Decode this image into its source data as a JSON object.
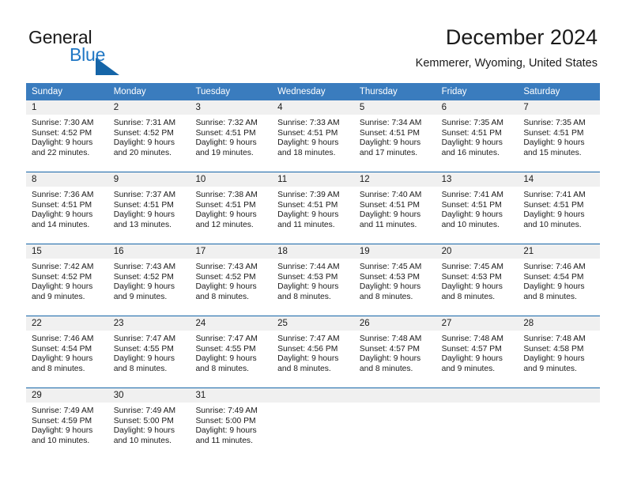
{
  "brand": {
    "word1": "General",
    "word2": "Blue",
    "accent_color": "#1565a8",
    "text_color": "#1a1a1a"
  },
  "header": {
    "title": "December 2024",
    "subtitle": "Kemmerer, Wyoming, United States"
  },
  "theme": {
    "header_bg": "#3a7cbe",
    "header_text": "#ffffff",
    "row_divider": "#1565a8",
    "day_strip_bg": "#f0f0f0"
  },
  "weekdays": [
    "Sunday",
    "Monday",
    "Tuesday",
    "Wednesday",
    "Thursday",
    "Friday",
    "Saturday"
  ],
  "weeks": [
    [
      {
        "day": "1",
        "sunrise": "Sunrise: 7:30 AM",
        "sunset": "Sunset: 4:52 PM",
        "daylight1": "Daylight: 9 hours",
        "daylight2": "and 22 minutes."
      },
      {
        "day": "2",
        "sunrise": "Sunrise: 7:31 AM",
        "sunset": "Sunset: 4:52 PM",
        "daylight1": "Daylight: 9 hours",
        "daylight2": "and 20 minutes."
      },
      {
        "day": "3",
        "sunrise": "Sunrise: 7:32 AM",
        "sunset": "Sunset: 4:51 PM",
        "daylight1": "Daylight: 9 hours",
        "daylight2": "and 19 minutes."
      },
      {
        "day": "4",
        "sunrise": "Sunrise: 7:33 AM",
        "sunset": "Sunset: 4:51 PM",
        "daylight1": "Daylight: 9 hours",
        "daylight2": "and 18 minutes."
      },
      {
        "day": "5",
        "sunrise": "Sunrise: 7:34 AM",
        "sunset": "Sunset: 4:51 PM",
        "daylight1": "Daylight: 9 hours",
        "daylight2": "and 17 minutes."
      },
      {
        "day": "6",
        "sunrise": "Sunrise: 7:35 AM",
        "sunset": "Sunset: 4:51 PM",
        "daylight1": "Daylight: 9 hours",
        "daylight2": "and 16 minutes."
      },
      {
        "day": "7",
        "sunrise": "Sunrise: 7:35 AM",
        "sunset": "Sunset: 4:51 PM",
        "daylight1": "Daylight: 9 hours",
        "daylight2": "and 15 minutes."
      }
    ],
    [
      {
        "day": "8",
        "sunrise": "Sunrise: 7:36 AM",
        "sunset": "Sunset: 4:51 PM",
        "daylight1": "Daylight: 9 hours",
        "daylight2": "and 14 minutes."
      },
      {
        "day": "9",
        "sunrise": "Sunrise: 7:37 AM",
        "sunset": "Sunset: 4:51 PM",
        "daylight1": "Daylight: 9 hours",
        "daylight2": "and 13 minutes."
      },
      {
        "day": "10",
        "sunrise": "Sunrise: 7:38 AM",
        "sunset": "Sunset: 4:51 PM",
        "daylight1": "Daylight: 9 hours",
        "daylight2": "and 12 minutes."
      },
      {
        "day": "11",
        "sunrise": "Sunrise: 7:39 AM",
        "sunset": "Sunset: 4:51 PM",
        "daylight1": "Daylight: 9 hours",
        "daylight2": "and 11 minutes."
      },
      {
        "day": "12",
        "sunrise": "Sunrise: 7:40 AM",
        "sunset": "Sunset: 4:51 PM",
        "daylight1": "Daylight: 9 hours",
        "daylight2": "and 11 minutes."
      },
      {
        "day": "13",
        "sunrise": "Sunrise: 7:41 AM",
        "sunset": "Sunset: 4:51 PM",
        "daylight1": "Daylight: 9 hours",
        "daylight2": "and 10 minutes."
      },
      {
        "day": "14",
        "sunrise": "Sunrise: 7:41 AM",
        "sunset": "Sunset: 4:51 PM",
        "daylight1": "Daylight: 9 hours",
        "daylight2": "and 10 minutes."
      }
    ],
    [
      {
        "day": "15",
        "sunrise": "Sunrise: 7:42 AM",
        "sunset": "Sunset: 4:52 PM",
        "daylight1": "Daylight: 9 hours",
        "daylight2": "and 9 minutes."
      },
      {
        "day": "16",
        "sunrise": "Sunrise: 7:43 AM",
        "sunset": "Sunset: 4:52 PM",
        "daylight1": "Daylight: 9 hours",
        "daylight2": "and 9 minutes."
      },
      {
        "day": "17",
        "sunrise": "Sunrise: 7:43 AM",
        "sunset": "Sunset: 4:52 PM",
        "daylight1": "Daylight: 9 hours",
        "daylight2": "and 8 minutes."
      },
      {
        "day": "18",
        "sunrise": "Sunrise: 7:44 AM",
        "sunset": "Sunset: 4:53 PM",
        "daylight1": "Daylight: 9 hours",
        "daylight2": "and 8 minutes."
      },
      {
        "day": "19",
        "sunrise": "Sunrise: 7:45 AM",
        "sunset": "Sunset: 4:53 PM",
        "daylight1": "Daylight: 9 hours",
        "daylight2": "and 8 minutes."
      },
      {
        "day": "20",
        "sunrise": "Sunrise: 7:45 AM",
        "sunset": "Sunset: 4:53 PM",
        "daylight1": "Daylight: 9 hours",
        "daylight2": "and 8 minutes."
      },
      {
        "day": "21",
        "sunrise": "Sunrise: 7:46 AM",
        "sunset": "Sunset: 4:54 PM",
        "daylight1": "Daylight: 9 hours",
        "daylight2": "and 8 minutes."
      }
    ],
    [
      {
        "day": "22",
        "sunrise": "Sunrise: 7:46 AM",
        "sunset": "Sunset: 4:54 PM",
        "daylight1": "Daylight: 9 hours",
        "daylight2": "and 8 minutes."
      },
      {
        "day": "23",
        "sunrise": "Sunrise: 7:47 AM",
        "sunset": "Sunset: 4:55 PM",
        "daylight1": "Daylight: 9 hours",
        "daylight2": "and 8 minutes."
      },
      {
        "day": "24",
        "sunrise": "Sunrise: 7:47 AM",
        "sunset": "Sunset: 4:55 PM",
        "daylight1": "Daylight: 9 hours",
        "daylight2": "and 8 minutes."
      },
      {
        "day": "25",
        "sunrise": "Sunrise: 7:47 AM",
        "sunset": "Sunset: 4:56 PM",
        "daylight1": "Daylight: 9 hours",
        "daylight2": "and 8 minutes."
      },
      {
        "day": "26",
        "sunrise": "Sunrise: 7:48 AM",
        "sunset": "Sunset: 4:57 PM",
        "daylight1": "Daylight: 9 hours",
        "daylight2": "and 8 minutes."
      },
      {
        "day": "27",
        "sunrise": "Sunrise: 7:48 AM",
        "sunset": "Sunset: 4:57 PM",
        "daylight1": "Daylight: 9 hours",
        "daylight2": "and 9 minutes."
      },
      {
        "day": "28",
        "sunrise": "Sunrise: 7:48 AM",
        "sunset": "Sunset: 4:58 PM",
        "daylight1": "Daylight: 9 hours",
        "daylight2": "and 9 minutes."
      }
    ],
    [
      {
        "day": "29",
        "sunrise": "Sunrise: 7:49 AM",
        "sunset": "Sunset: 4:59 PM",
        "daylight1": "Daylight: 9 hours",
        "daylight2": "and 10 minutes."
      },
      {
        "day": "30",
        "sunrise": "Sunrise: 7:49 AM",
        "sunset": "Sunset: 5:00 PM",
        "daylight1": "Daylight: 9 hours",
        "daylight2": "and 10 minutes."
      },
      {
        "day": "31",
        "sunrise": "Sunrise: 7:49 AM",
        "sunset": "Sunset: 5:00 PM",
        "daylight1": "Daylight: 9 hours",
        "daylight2": "and 11 minutes."
      },
      {
        "day": "",
        "sunrise": "",
        "sunset": "",
        "daylight1": "",
        "daylight2": ""
      },
      {
        "day": "",
        "sunrise": "",
        "sunset": "",
        "daylight1": "",
        "daylight2": ""
      },
      {
        "day": "",
        "sunrise": "",
        "sunset": "",
        "daylight1": "",
        "daylight2": ""
      },
      {
        "day": "",
        "sunrise": "",
        "sunset": "",
        "daylight1": "",
        "daylight2": ""
      }
    ]
  ]
}
